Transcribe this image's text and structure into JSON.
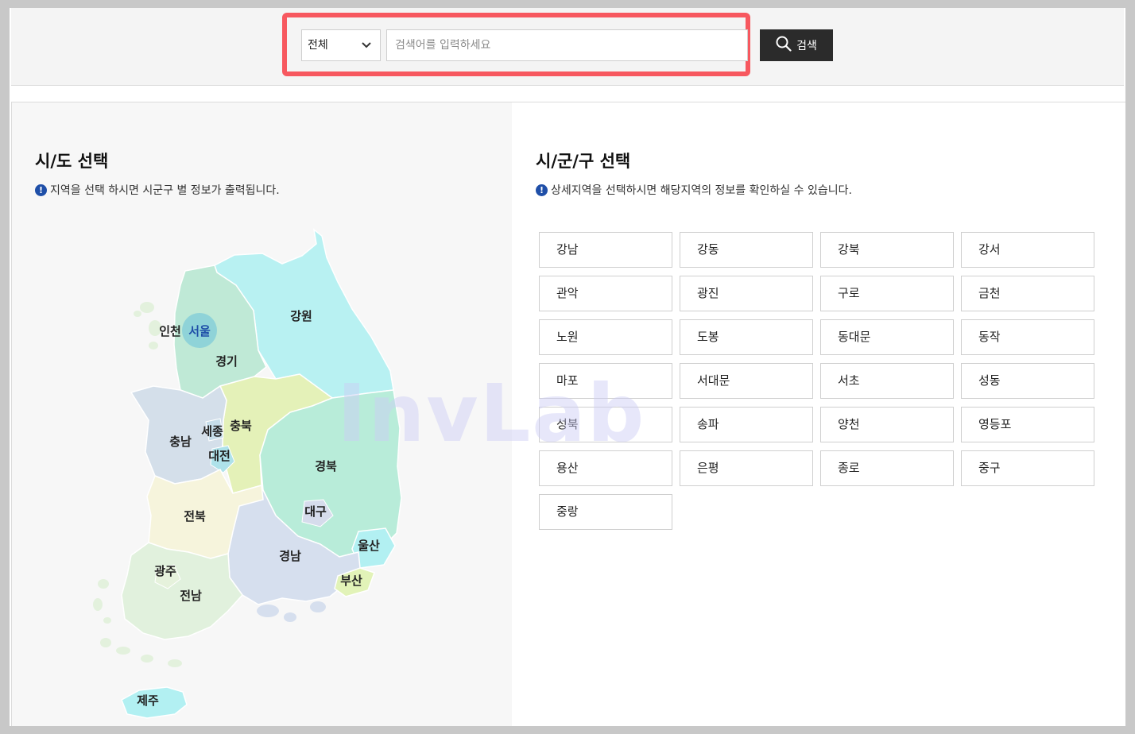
{
  "search": {
    "category_selected": "전체",
    "placeholder": "검색어를 입력하세요",
    "button_label": "검색"
  },
  "left_panel": {
    "title": "시/도 선택",
    "info": "지역을 선택 하시면 시군구 별 정보가 출력됩니다.",
    "info_icon": "!"
  },
  "map": {
    "regions": [
      {
        "name": "인천",
        "color": "#cfe9d6"
      },
      {
        "name": "서울",
        "color": "#8fd3d8"
      },
      {
        "name": "경기",
        "color": "#bfe9d6"
      },
      {
        "name": "강원",
        "color": "#b8f1f2"
      },
      {
        "name": "충남",
        "color": "#d4dfea"
      },
      {
        "name": "세종",
        "color": "#c6ddea"
      },
      {
        "name": "충북",
        "color": "#e4f1b8"
      },
      {
        "name": "대전",
        "color": "#aee2ea"
      },
      {
        "name": "경북",
        "color": "#b8ecd9"
      },
      {
        "name": "대구",
        "color": "#d6dcec"
      },
      {
        "name": "전북",
        "color": "#f6f4dc"
      },
      {
        "name": "울산",
        "color": "#b2f0f2"
      },
      {
        "name": "경남",
        "color": "#d6dfee"
      },
      {
        "name": "광주",
        "color": "#e6f2dc"
      },
      {
        "name": "부산",
        "color": "#e2f3b8"
      },
      {
        "name": "전남",
        "color": "#e1f1dd"
      },
      {
        "name": "제주",
        "color": "#b2f0f2"
      }
    ]
  },
  "right_panel": {
    "title": "시/군/구 선택",
    "info": "상세지역을 선택하시면 해당지역의 정보를 확인하실 수 있습니다.",
    "info_icon": "!",
    "districts": [
      "강남",
      "강동",
      "강북",
      "강서",
      "관악",
      "광진",
      "구로",
      "금천",
      "노원",
      "도봉",
      "동대문",
      "동작",
      "마포",
      "서대문",
      "서초",
      "성동",
      "성북",
      "송파",
      "양천",
      "영등포",
      "용산",
      "은평",
      "종로",
      "중구",
      "중랑"
    ]
  },
  "watermark": "InvLab",
  "icons": {
    "search": "search-icon",
    "chevron": "chevron-down-icon",
    "info": "info-icon"
  }
}
